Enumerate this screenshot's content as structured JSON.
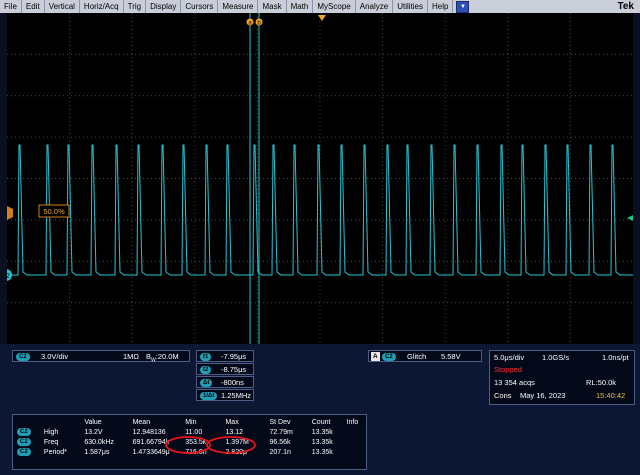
{
  "menu": {
    "items": [
      "File",
      "Edit",
      "Vertical",
      "Horiz/Acq",
      "Trig",
      "Display",
      "Cursors",
      "Measure",
      "Mask",
      "Math",
      "MyScope",
      "Analyze",
      "Utilities",
      "Help"
    ],
    "brand": "Tek"
  },
  "scope": {
    "cursor_labels": [
      "a",
      "b"
    ],
    "level_label": "50.0%",
    "channel_marker": "2",
    "trigger_marker": "T"
  },
  "channel": {
    "badge": "C2",
    "scale": "3.0V/div",
    "impedance": "1MΩ",
    "bw_prefix": "B",
    "bw_sub": "W",
    "bw": ":20.0M"
  },
  "cursors": {
    "t1_label": "t1",
    "t1": "-7.95μs",
    "t2_label": "t2",
    "t2": "-8.75μs",
    "dt_label": "Δt",
    "dt": "-800ns",
    "inv_label": "1/Δt",
    "inv": "1.25MHz"
  },
  "trigger": {
    "a_label": "A",
    "badge": "C2",
    "type": "Glitch",
    "level": "5.58V"
  },
  "acq": {
    "hscale": "5.0μs/div",
    "rate": "1.0GS/s",
    "res": "1.0ns/pt",
    "status": "Stopped",
    "acqs": "13 354 acqs",
    "rl": "RL:50.0k",
    "mode": "Cons",
    "date": "May 16, 2023",
    "time": "15:40:42"
  },
  "measurements": {
    "headers": [
      "Value",
      "Mean",
      "Min",
      "Max",
      "St Dev",
      "Count",
      "Info"
    ],
    "rows": [
      {
        "badge": "C2",
        "name": "High",
        "value": "13.2V",
        "mean": "12.948136",
        "min": "11.00",
        "max": "13.12",
        "stdev": "72.79m",
        "count": "13.35k",
        "info": ""
      },
      {
        "badge": "C2",
        "name": "Freq",
        "value": "630.0kHz",
        "mean": "691.66794k",
        "min": "353.5k",
        "max": "1.397M",
        "stdev": "96.56k",
        "count": "13.35k",
        "info": ""
      },
      {
        "badge": "C2",
        "name": "Period*",
        "value": "1.587μs",
        "mean": "1.4733649μ",
        "min": "716.0n",
        "max": "2.829μ",
        "stdev": "207.1n",
        "count": "13.35k",
        "info": ""
      }
    ]
  },
  "colors": {
    "trace": "#23c6d6",
    "menubar": "#c9ced8",
    "annotation": "#e8141c",
    "cursor": "#f2a41e"
  }
}
